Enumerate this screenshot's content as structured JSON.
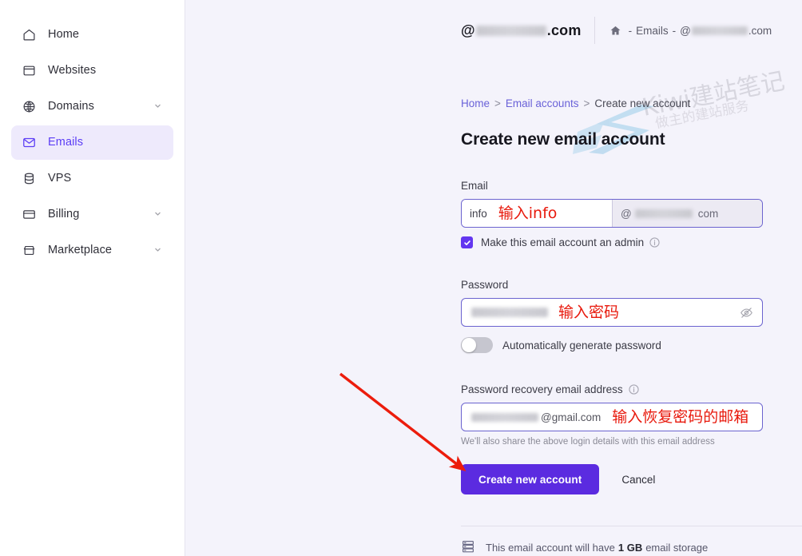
{
  "sidebar": {
    "items": [
      {
        "label": "Home",
        "icon": "home-icon",
        "active": false,
        "caret": false
      },
      {
        "label": "Websites",
        "icon": "window-icon",
        "active": false,
        "caret": false
      },
      {
        "label": "Domains",
        "icon": "globe-icon",
        "active": false,
        "caret": true
      },
      {
        "label": "Emails",
        "icon": "envelope-icon",
        "active": true,
        "caret": false
      },
      {
        "label": "VPS",
        "icon": "server-icon",
        "active": false,
        "caret": false
      },
      {
        "label": "Billing",
        "icon": "credit-card-icon",
        "active": false,
        "caret": true
      },
      {
        "label": "Marketplace",
        "icon": "market-icon",
        "active": false,
        "caret": true
      }
    ]
  },
  "topbar": {
    "account_prefix": "@",
    "account_suffix": ".com",
    "nav_home_icon": "home-icon",
    "nav_dash_1": "-",
    "nav_emails": "Emails",
    "nav_dash_2": "-",
    "nav_at": "@",
    "nav_suffix": ".com"
  },
  "breadcrumb": {
    "home": "Home",
    "sep": ">",
    "email_accounts": "Email accounts",
    "current": "Create new account"
  },
  "page": {
    "title": "Create new email account"
  },
  "form": {
    "email_label": "Email",
    "email_value": "info",
    "email_annotation": "输入info",
    "email_domain_at": "@",
    "email_domain_suffix": "com",
    "admin_checkbox_label": "Make this email account an admin",
    "admin_checkbox_checked": true,
    "admin_info_icon": "info-icon",
    "password_label": "Password",
    "password_annotation": "输入密码",
    "password_eye_icon": "eye-off-icon",
    "generate_toggle_label": "Automatically generate password",
    "generate_toggle_on": false,
    "recovery_label": "Password recovery email address",
    "recovery_info_icon": "info-icon",
    "recovery_value_suffix": "@gmail.com",
    "recovery_annotation": "输入恢复密码的邮箱",
    "recovery_help": "We'll also share the above login details with this email address",
    "submit_label": "Create new account",
    "cancel_label": "Cancel"
  },
  "footer": {
    "storage_icon": "storage-icon",
    "text_before": "This email account will have",
    "storage_amount": "1 GB",
    "text_after": "email storage"
  },
  "watermark": {
    "line1": "Kiwi建站笔记",
    "line2": "做主的建站服务"
  },
  "annotations": {
    "arrow_color": "#ec1c0c"
  },
  "colors": {
    "accent": "#5b2be0",
    "active_nav_bg": "#eeeafc",
    "active_nav_text": "#5b3df5",
    "main_bg": "#f4f3fb",
    "annotation_red": "#e8190c"
  }
}
